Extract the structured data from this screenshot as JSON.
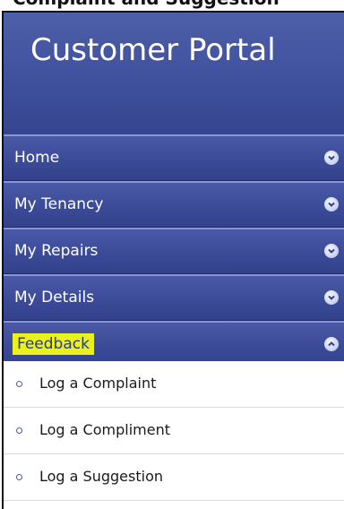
{
  "caption": "Complaint and Suggestion",
  "portal": {
    "title": "Customer Portal"
  },
  "nav": {
    "items": [
      {
        "label": "Home",
        "icon": "chevron-down-icon",
        "expanded": false
      },
      {
        "label": "My Tenancy",
        "icon": "chevron-down-icon",
        "expanded": false
      },
      {
        "label": "My Repairs",
        "icon": "chevron-down-icon",
        "expanded": false
      },
      {
        "label": "My Details",
        "icon": "chevron-down-icon",
        "expanded": false
      },
      {
        "label": "Feedback",
        "icon": "chevron-up-icon",
        "expanded": true,
        "highlighted": true
      }
    ]
  },
  "feedback_menu": {
    "items": [
      {
        "label": "Log a Complaint"
      },
      {
        "label": "Log a Compliment"
      },
      {
        "label": "Log a Suggestion"
      }
    ]
  },
  "colors": {
    "nav_background": "#3b4b98",
    "highlight": "#eaf21a",
    "highlight_text": "#2a3a8a"
  }
}
